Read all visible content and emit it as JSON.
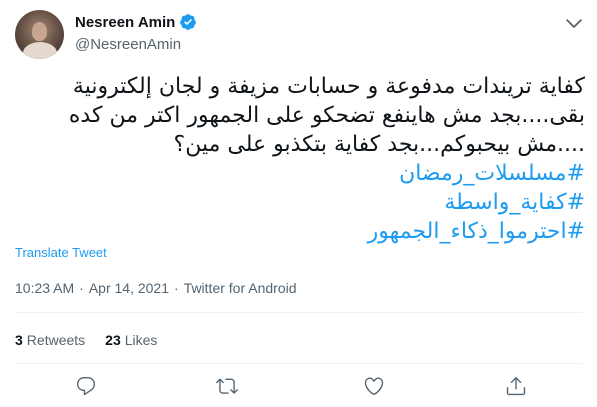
{
  "author": {
    "display_name": "Nesreen Amin",
    "handle": "@NesreenAmin",
    "verified": true
  },
  "tweet": {
    "lines": [
      "كفاية تريندات مدفوعة و حسابات مزيفة و لجان إلكترونية",
      "بقى....بجد مش هاينفع تضحكو على الجمهور اكتر من كده",
      "....مش بيحبوكم...بجد كفاية بتكذبو على مين؟"
    ],
    "hashtags": [
      "#مسلسلات_رمضان",
      "#كفاية_واسطة",
      "#احترموا_ذكاء_الجمهور"
    ]
  },
  "translate_label": "Translate Tweet",
  "meta": {
    "time": "10:23 AM",
    "separator": "·",
    "date": "Apr 14, 2021",
    "source": "Twitter for Android"
  },
  "stats": {
    "retweets_count": "3",
    "retweets_label": "Retweets",
    "likes_count": "23",
    "likes_label": "Likes"
  },
  "icons": {
    "verified": "verified-badge-icon",
    "caret": "chevron-down-icon",
    "reply": "reply-icon",
    "retweet": "retweet-icon",
    "like": "heart-icon",
    "share": "share-icon"
  },
  "colors": {
    "accent": "#1d9bf0",
    "secondary_text": "#536471",
    "primary_text": "#0f1419"
  }
}
